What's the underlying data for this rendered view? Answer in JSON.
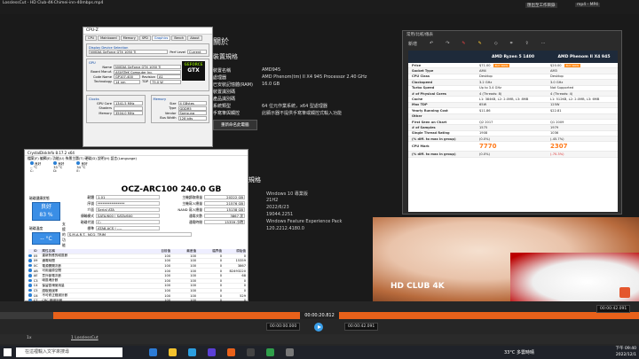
{
  "app": {
    "title": "LosslessCut - HD Club-4K-Chimei-inn-40mbps.mp4",
    "menu": [
      "檔案",
      "編輯",
      "選取",
      "工具",
      "檢視",
      "說明"
    ],
    "export_label": "匯出至工作目錄",
    "format_label": "mp4 - MP4"
  },
  "about": {
    "heading": "關於",
    "section": "裝置規格",
    "rows": [
      {
        "k": "裝置名稱",
        "v": "AMD945"
      },
      {
        "k": "處理器",
        "v": "AMD Phenom(tm) II X4 945 Processor  2.40 GHz"
      },
      {
        "k": "已安裝記憶體(RAM)",
        "v": "16.0 GB"
      },
      {
        "k": "裝置識別碼",
        "v": ""
      },
      {
        "k": "產品識別碼",
        "v": ""
      },
      {
        "k": "系統類型",
        "v": "64 位元作業系統，x64 型處理器"
      },
      {
        "k": "手寫筆與觸控",
        "v": "此顯示器不提供手寫筆或觸控式輸入功能"
      }
    ],
    "rename_button": "重新命名此電腦"
  },
  "win_spec": {
    "heading": "規格",
    "lines": [
      "Windows 10 專業版",
      "21H2",
      "2022/6/23",
      "19044.2251",
      "Windows Feature Experience Pack",
      "120.2212.4180.0"
    ]
  },
  "cpuz": {
    "title": "CPU-Z",
    "tabs": [
      "CPU",
      "Mainboard",
      "Memory",
      "SPD",
      "Graphics",
      "Bench",
      "About"
    ],
    "active_tab": "Graphics",
    "display_device_label": "Display Device Selection",
    "device": "NVIDIA GeForce GTX 1050 Ti",
    "perf_label": "Perf Level",
    "perf_value": "Current",
    "gpu_group": "GPU",
    "gpu": [
      {
        "k": "Name",
        "v": "NVIDIA GeForce GTX 1050 Ti"
      },
      {
        "k": "Board Manuf.",
        "v": "ASUSTeK Computer Inc."
      },
      {
        "k": "Code Name",
        "v": "GP107-400"
      },
      {
        "k": "Technology",
        "v": "14 nm"
      }
    ],
    "revision_label": "Revision",
    "revision": "A1",
    "tdp_label": "TDP",
    "tdp": "75.0 W",
    "logo_line1": "GEFORCE",
    "logo_line2": "GTX",
    "clocks_group": "Clocks",
    "clocks": [
      {
        "k": "GPU Core",
        "v": "1341.5 MHz"
      },
      {
        "k": "Shaders",
        "v": ""
      },
      {
        "k": "Memory",
        "v": "3504.0 MHz"
      }
    ],
    "memory_group": "Memory",
    "memory": [
      {
        "k": "Size",
        "v": "4 GBytes"
      },
      {
        "k": "Type",
        "v": "GDDR5"
      },
      {
        "k": "Vendor",
        "v": "Samsung"
      },
      {
        "k": "Bus Width",
        "v": "128 bits"
      }
    ]
  },
  "cdi": {
    "title": "CrystalDiskInfo 8.17.2 x64",
    "menu": "檔案(F)  編輯(E)  功能(U)  佈景主題(T)  硬碟(D)  說明(H)  語言(Language)",
    "drives": [
      {
        "status": "良好",
        "temp": "-- °C",
        "letter": "C:"
      },
      {
        "status": "良好",
        "temp": "33 °C",
        "letter": "D:"
      },
      {
        "status": "良好",
        "temp": "34 °C",
        "letter": "E:"
      }
    ],
    "disk_title": "OCZ-ARC100 240.0 GB",
    "health_label": "磁碟健康狀態",
    "health_status": "良好",
    "health_pct": "83 %",
    "temp_label": "磁碟溫度",
    "temp_value": "-- °C",
    "left": [
      {
        "k": "韌體",
        "v": "1.01"
      },
      {
        "k": "序號",
        "v": "****************"
      },
      {
        "k": "介面",
        "v": "Serial ATA"
      },
      {
        "k": "傳輸模式",
        "v": "SATA/600 | SATA/600"
      },
      {
        "k": "磁碟代號",
        "v": "C:"
      },
      {
        "k": "標準",
        "v": "ATA8-ACS | ----"
      },
      {
        "k": "支援的功能",
        "v": "S.M.A.R.T., NCQ, TRIM"
      }
    ],
    "right": [
      {
        "k": "主機讀取總量",
        "v": "20222 GB"
      },
      {
        "k": "主機寫入總量",
        "v": "21576 GB"
      },
      {
        "k": "NAND 寫入總量",
        "v": "15138 GB"
      },
      {
        "k": "通電次數",
        "v": "3867 次"
      },
      {
        "k": "通電時間",
        "v": "15359 小時"
      }
    ],
    "smart_headers": [
      "ID",
      "屬性名稱",
      "目前值",
      "最差值",
      "臨界值",
      "原始值"
    ],
    "smart_rows": [
      {
        "id": "05",
        "name": "重新對應的磁區數",
        "cur": "100",
        "worst": "100",
        "thr": "0",
        "raw": "0"
      },
      {
        "id": "09",
        "name": "通電時間",
        "cur": "100",
        "worst": "100",
        "thr": "0",
        "raw": "15359"
      },
      {
        "id": "0C",
        "name": "電源開關次數",
        "cur": "100",
        "worst": "100",
        "thr": "0",
        "raw": "3867"
      },
      {
        "id": "AB",
        "name": "可用還原空間",
        "cur": "100",
        "worst": "100",
        "thr": "0",
        "raw": "B2493220"
      },
      {
        "id": "AE",
        "name": "意外斷電次數",
        "cur": "100",
        "worst": "100",
        "thr": "0",
        "raw": "68"
      },
      {
        "id": "C3",
        "name": "壞區塊計數",
        "cur": "100",
        "worst": "100",
        "thr": "0",
        "raw": "0"
      },
      {
        "id": "C4",
        "name": "保留區塊使用量",
        "cur": "100",
        "worst": "100",
        "thr": "0",
        "raw": "0"
      },
      {
        "id": "C5",
        "name": "讀取錯誤率",
        "cur": "100",
        "worst": "100",
        "thr": "0",
        "raw": "0"
      },
      {
        "id": "C6",
        "name": "不可修正錯誤計數",
        "cur": "100",
        "worst": "100",
        "thr": "0",
        "raw": "529"
      },
      {
        "id": "C7",
        "name": "CRC 錯誤計數",
        "cur": "100",
        "worst": "100",
        "thr": "0",
        "raw": "0"
      },
      {
        "id": "DA",
        "name": "SATA 高速傳輸模式錯誤計數",
        "cur": "100",
        "worst": "100",
        "thr": "0",
        "raw": "0"
      }
    ]
  },
  "cmp": {
    "title": "常用/比較/儀表",
    "toolbar": [
      "新增"
    ],
    "col1": "AMD Ryzen 5 1400",
    "col2": "AMD Phenom II X4 945",
    "rows": [
      {
        "k": "Price",
        "a": "$71.00",
        "b": "$20.00",
        "buy": true
      },
      {
        "k": "Socket Type",
        "a": "AM4",
        "b": "AM3"
      },
      {
        "k": "CPU Class",
        "a": "Desktop",
        "b": "Desktop"
      },
      {
        "k": "Clockspeed",
        "a": "3.2 GHz",
        "b": "3.0 GHz"
      },
      {
        "k": "Turbo Speed",
        "a": "Up to 3.4 GHz",
        "b": "Not Supported"
      },
      {
        "k": "# of Physical Cores",
        "a": "4 (Threads: 8)",
        "b": "4 (Threads: 4)"
      },
      {
        "k": "Cache",
        "a": "L1: 384KB, L2: 2.0MB, L3: 8MB",
        "b": "L1: 512KB, L2: 2.0MB, L3: 6MB"
      },
      {
        "k": "Max TDP",
        "a": "65W",
        "b": "125W"
      },
      {
        "k": "Yearly Running Cost",
        "a": "$11.86",
        "b": "$22.81"
      },
      {
        "k": "Other",
        "a": "",
        "b": ""
      },
      {
        "k": "First Seen on Chart",
        "a": "Q2 2017",
        "b": "Q1 2009"
      },
      {
        "k": "# of Samples",
        "a": "1575",
        "b": "1979"
      },
      {
        "k": "Single Thread Rating",
        "a": "1908",
        "b": "1036"
      },
      {
        "k": "(% diff. to max in group)",
        "a": "(0.0%)",
        "b": "(-45.7%)"
      }
    ],
    "cpu_mark_label": "CPU Mark",
    "cpu_mark_a": "7770",
    "cpu_mark_b": "2307",
    "diff_label": "(% diff. to max in group)",
    "diff_a": "(0.0%)",
    "diff_b": "(-70.3%)"
  },
  "player": {
    "current_time": "00:00:20.812",
    "start_time": "00:00:00.000",
    "end_time": "00:00:42.091",
    "duration": "00:00:42.091",
    "zoom": "1x",
    "track_label": "1 LosslessCut"
  },
  "watermark": "HD CLUB 4K",
  "taskbar": {
    "search_placeholder": "在這裡輸入文字來搜尋",
    "weather": "33°C  多雲時晴",
    "time": "下午 09:40",
    "date": "2022/12/1"
  }
}
